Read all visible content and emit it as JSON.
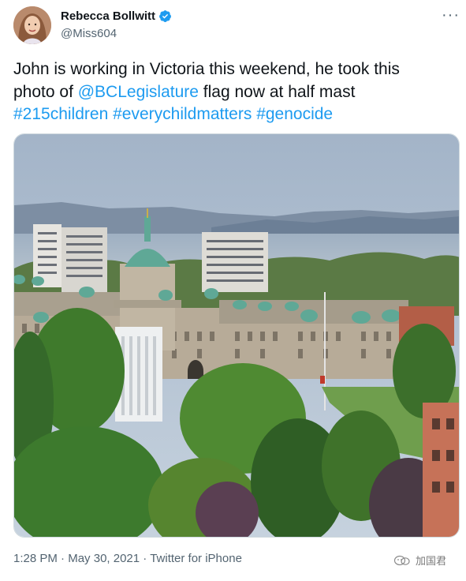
{
  "tweet": {
    "author": {
      "display_name": "Rebecca Bollwitt",
      "handle": "@Miss604",
      "verified": true
    },
    "more_icon": "more-horizontal-icon",
    "text": {
      "line1": "John is working in Victoria this weekend, he took this",
      "line2_prefix": "photo of ",
      "mention": "@BCLegislature",
      "line2_suffix": " flag now at half mast",
      "hashtags": [
        "#215children",
        "#everychildmatters",
        "#genocide"
      ]
    },
    "meta": {
      "time": "1:28 PM",
      "separator": " · ",
      "date": "May 30, 2021",
      "source": "Twitter for iPhone"
    }
  },
  "watermark": {
    "label": "加国君",
    "icon": "wechat-icon"
  },
  "colors": {
    "link": "#1d9bf0",
    "secondary_text": "#536471",
    "primary_text": "#0f1419"
  }
}
